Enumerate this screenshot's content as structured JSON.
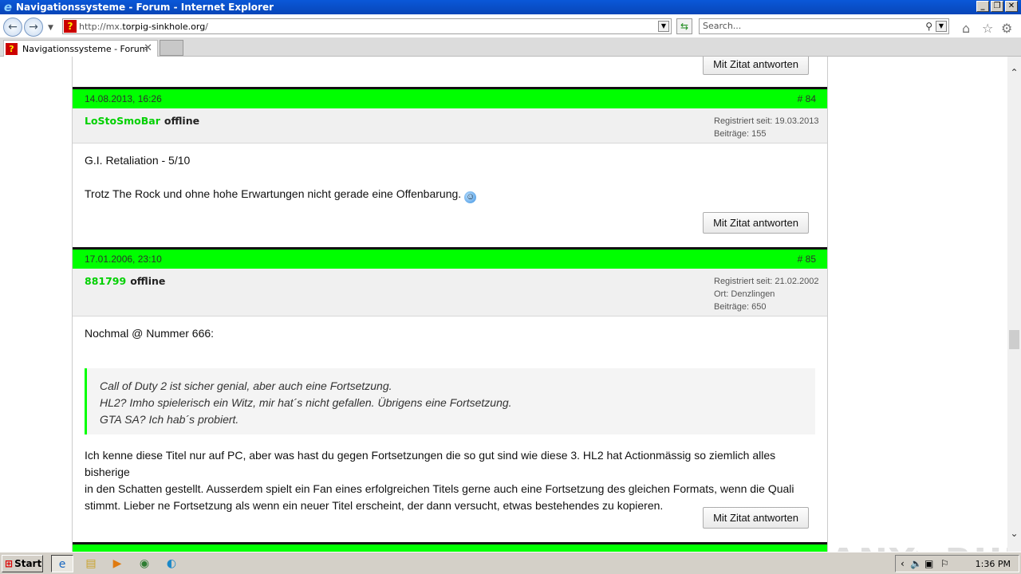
{
  "window": {
    "title": "Navigationssysteme - Forum - Internet Explorer",
    "minimize": "_",
    "restore": "❐",
    "close": "✕"
  },
  "nav": {
    "url_prefix": "http://mx.",
    "url_domain": "torpig-sinkhole.org",
    "url_suffix": "/",
    "search_placeholder": "Search..."
  },
  "tab": {
    "title": "Navigationssysteme - Forum",
    "close": "✕"
  },
  "reply_label": "Mit Zitat antworten",
  "posts": [
    {
      "date": "14.08.2013, 16:26",
      "number": "# 84",
      "user": "LoStoSmoBar",
      "status": "offline",
      "info": [
        "Registriert seit: 19.03.2013",
        "Beiträge: 155"
      ],
      "lines": [
        "G.I. Retaliation - 5/10",
        "Trotz The Rock und ohne hohe Erwartungen nicht gerade eine Offenbarung."
      ]
    },
    {
      "date": "17.01.2006, 23:10",
      "number": "# 85",
      "user": "881799",
      "status": "offline",
      "info": [
        "Registriert seit: 21.02.2002",
        "Ort: Denzlingen",
        "Beiträge: 650"
      ],
      "intro": "Nochmal @ Nummer 666:",
      "quote": [
        "Call of Duty 2 ist sicher genial, aber auch eine Fortsetzung.",
        "HL2? Imho spielerisch ein Witz, mir hat´s nicht gefallen. Übrigens eine Fortsetzung.",
        "GTA SA? Ich hab´s probiert."
      ],
      "body": [
        "Ich kenne diese Titel nur auf PC, aber was hast du gegen Fortsetzungen die so gut sind wie diese 3. HL2 hat Actionmässig so ziemlich alles bisherige",
        "in den Schatten gestellt. Ausserdem spielt ein Fan eines erfolgreichen Titels gerne auch eine Fortsetzung des gleichen Formats, wenn die Quali",
        "stimmt. Lieber ne Fortsetzung als wenn ein neuer Titel erscheint, der dann versucht, etwas bestehendes zu kopieren."
      ]
    }
  ],
  "watermark": "ANY▷RUN",
  "taskbar": {
    "start": "Start",
    "clock": "1:36 PM"
  }
}
